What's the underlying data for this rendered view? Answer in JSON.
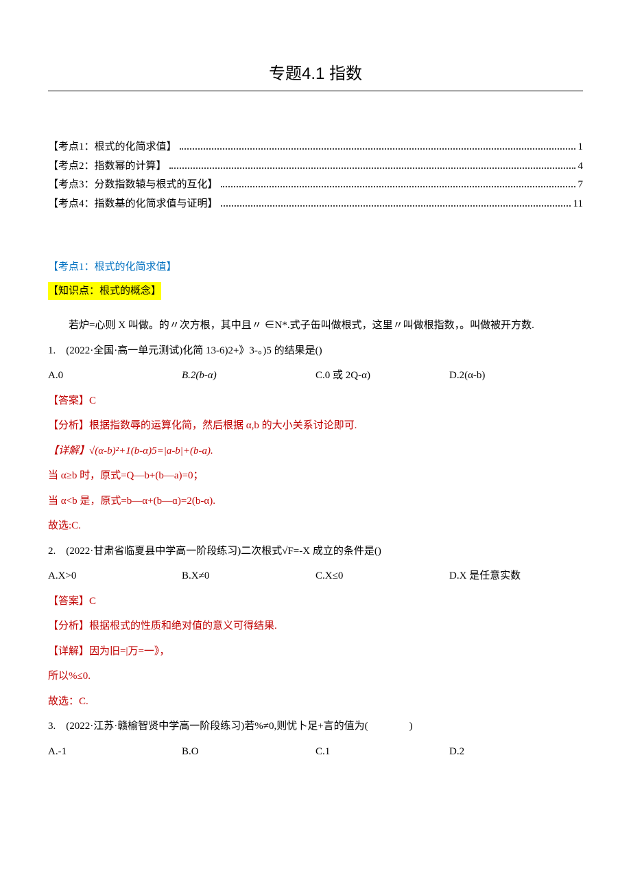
{
  "title": "专题4.1 指数",
  "toc": [
    {
      "label": "【考点1：根式的化简求值】",
      "page": "1"
    },
    {
      "label": "【考点2：指数幂的计算】",
      "page": "4"
    },
    {
      "label": "【考点3：分数指数辕与根式的互化】",
      "page": "7"
    },
    {
      "label": "【考点4：指数基的化简求值与证明】",
      "page": "11"
    }
  ],
  "section1": {
    "heading": "【考点1：根式的化简求值】",
    "knowledge": "【知识点：根式的概念】",
    "concept": "若炉=心则 X 叫做。的〃次方根，其中且〃 ∈N*.式子缶叫做根式，这里〃叫做根指数，。叫做被开方数."
  },
  "q1": {
    "stem": "1.　(2022·全国·高一单元测试)化简 13-6)2+》3-。)5 的结果是()",
    "opts": {
      "A": "A.0",
      "B": "B.2(b-α)",
      "C": "C.0 或 2Q-α)",
      "D": "D.2(α-b)"
    },
    "ans": "【答案】C",
    "analysis": "【分析】根据指数辱的运算化简，然后根据 α,b 的大小关系讨论即可.",
    "detail": "【详解】√(α-b)²+1(b-α)5=|a-b|+(b-a).",
    "case1": "当 α≥b 时，原式=Q—b+(b—a)=0；",
    "case2": "当 α<b 是，原式=b—α+(b—ɑ)=2(b-α).",
    "choose": "故选:C."
  },
  "q2": {
    "stem": "2.　(2022·甘肃省临夏县中学高一阶段练习)二次根式√F=-X 成立的条件是()",
    "opts": {
      "A": "A.X>0",
      "B": "B.X≠0",
      "C": "C.X≤0",
      "D": "D.X 是任意实数"
    },
    "ans": "【答案】C",
    "analysis": "【分析】根据根式的性质和绝对值的意义可得结果.",
    "detail": "【详解】因为旧=|万=一》，",
    "so": "所以%≤0.",
    "choose": "故选：C."
  },
  "q3": {
    "stem": "3.　(2022·江苏·赣榆智贤中学高一阶段练习)若%≠0,则忧卜足+言的值为(　　　　)",
    "opts": {
      "A": "A.-1",
      "B": "B.O",
      "C": "C.1",
      "D": "D.2"
    }
  }
}
